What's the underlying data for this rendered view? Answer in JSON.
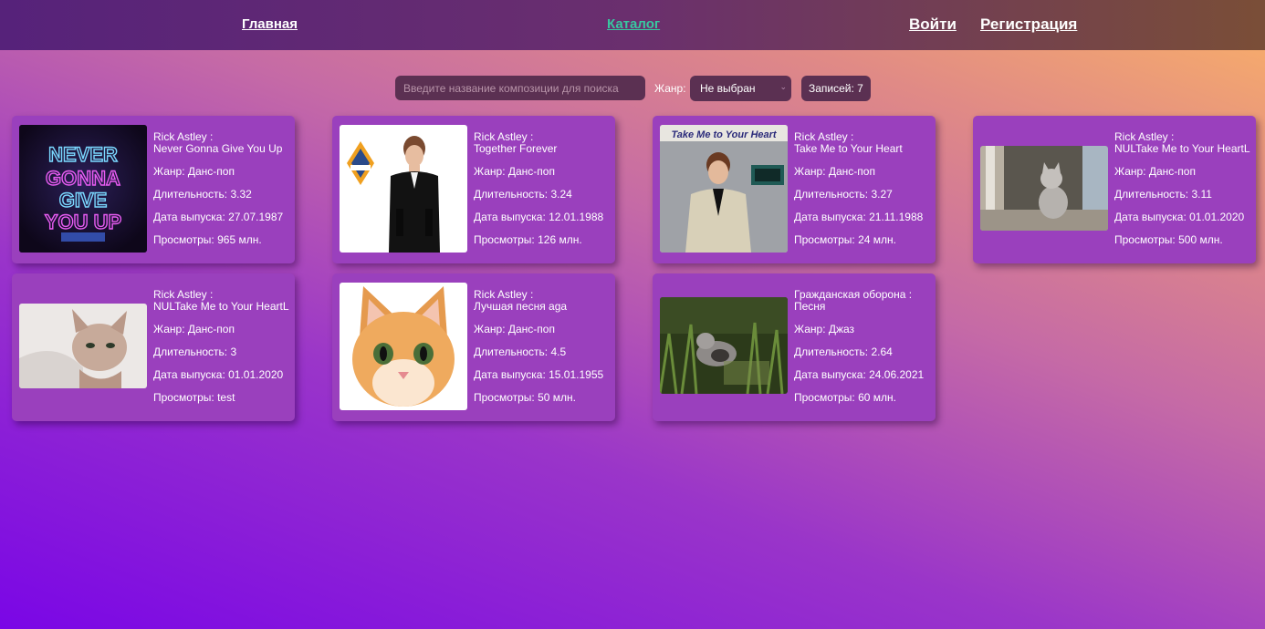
{
  "nav": {
    "home": "Главная",
    "catalog": "Каталог",
    "login": "Войти",
    "register": "Регистрация"
  },
  "filters": {
    "search_placeholder": "Введите название композиции для поиска",
    "search_value": "",
    "genre_label": "Жанр:",
    "genre_selected": "Не выбран",
    "records_count": "Записей: 7"
  },
  "cards": [
    {
      "artist": "Rick Astley :",
      "title": "Never Gonna Give You Up",
      "genre": "Жанр: Данс-поп",
      "duration": "Длительность: 3.32",
      "release": "Дата выпуска: 27.07.1987",
      "views": "Просмотры: 965 млн.",
      "cover_icon": "never-gonna-give-you-up-cover",
      "cover_text": "NEVER GONNA GIVE YOU UP"
    },
    {
      "artist": "Rick Astley :",
      "title": "Together Forever",
      "genre": "Жанр: Данс-поп",
      "duration": "Длительность: 3.24",
      "release": "Дата выпуска: 12.01.1988",
      "views": "Просмотры: 126 млн.",
      "cover_icon": "together-forever-cover"
    },
    {
      "artist": "Rick Astley :",
      "title": "Take Me to Your Heart",
      "genre": "Жанр: Данс-поп",
      "duration": "Длительность: 3.27",
      "release": "Дата выпуска: 21.11.1988",
      "views": "Просмотры: 24 млн.",
      "cover_icon": "take-me-to-your-heart-cover",
      "cover_text": "Take Me to Your Heart"
    },
    {
      "artist": "Rick Astley :",
      "title": "NULTake Me to Your HeartL",
      "genre": "Жанр: Данс-поп",
      "duration": "Длительность: 3.11",
      "release": "Дата выпуска: 01.01.2020",
      "views": "Просмотры: 500 млн.",
      "cover_icon": "gray-kitten-window-photo"
    },
    {
      "artist": "Rick Astley :",
      "title": "NULTake Me to Your HeartL",
      "genre": "Жанр: Данс-поп",
      "duration": "Длительность: 3",
      "release": "Дата выпуска: 01.01.2020",
      "views": "Просмотры: test",
      "cover_icon": "sphynx-cat-photo"
    },
    {
      "artist": "Rick Astley :",
      "title": "Лучшая песня aga",
      "genre": "Жанр: Данс-поп",
      "duration": "Длительность: 4.5",
      "release": "Дата выпуска: 15.01.1955",
      "views": "Просмотры: 50 млн.",
      "cover_icon": "ginger-kitten-photo"
    },
    {
      "artist": "Гражданская оборона :",
      "title": "Песня",
      "genre": "Жанр: Джаз",
      "duration": "Длительность: 2.64",
      "release": "Дата выпуска: 24.06.2021",
      "views": "Просмотры: 60 млн.",
      "cover_icon": "cat-in-grass-photo"
    }
  ]
}
